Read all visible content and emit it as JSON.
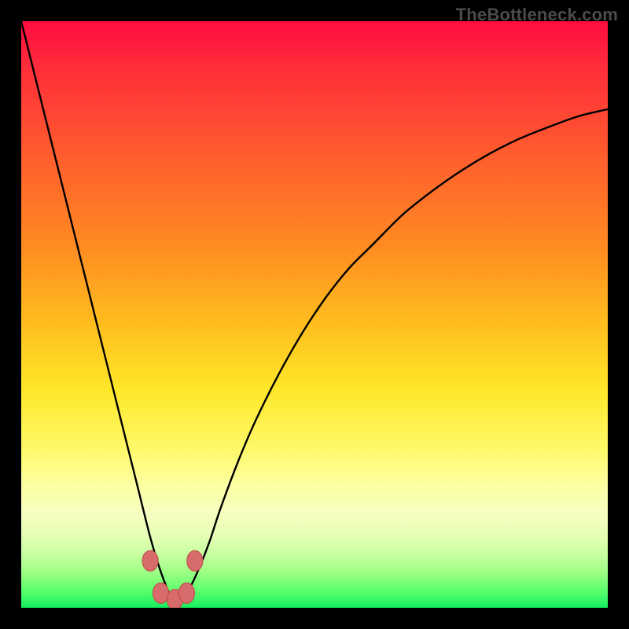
{
  "watermark": "TheBottleneck.com",
  "colors": {
    "frame": "#000000",
    "curve": "#000000",
    "marker_fill": "#d86b6b",
    "marker_stroke": "#c44f4f",
    "gradient_top": "#ff0d3f",
    "gradient_bottom": "#13ee5e"
  },
  "chart_data": {
    "type": "line",
    "title": "",
    "xlabel": "",
    "ylabel": "",
    "xlim": [
      0,
      100
    ],
    "ylim": [
      0,
      100
    ],
    "grid": false,
    "legend": false,
    "notes": "V-shaped bottleneck curve over red-to-green vertical gradient. Minimum near x≈26 where curve touches bottom. Right branch rises asymptotically toward ~85 at x=100. Values estimated from pixel positions; axes unlabeled.",
    "series": [
      {
        "name": "bottleneck-curve",
        "x": [
          0,
          2,
          4,
          6,
          8,
          10,
          12,
          14,
          16,
          18,
          20,
          22,
          23.5,
          25,
          26,
          27,
          28.5,
          30,
          32,
          34,
          37,
          40,
          44,
          48,
          52,
          56,
          60,
          65,
          70,
          75,
          80,
          85,
          90,
          95,
          100
        ],
        "y": [
          100,
          92,
          84,
          76,
          68,
          60,
          52,
          44,
          36,
          28,
          20,
          12,
          7,
          3,
          1.2,
          1.2,
          3,
          6,
          11,
          17,
          25,
          32,
          40,
          47,
          53,
          58,
          62,
          67,
          71,
          74.5,
          77.5,
          80,
          82,
          83.8,
          85
        ]
      }
    ],
    "markers": [
      {
        "x": 22.0,
        "y": 8.0
      },
      {
        "x": 23.8,
        "y": 2.5
      },
      {
        "x": 26.2,
        "y": 1.4
      },
      {
        "x": 28.2,
        "y": 2.5
      },
      {
        "x": 29.6,
        "y": 8.0
      }
    ]
  }
}
